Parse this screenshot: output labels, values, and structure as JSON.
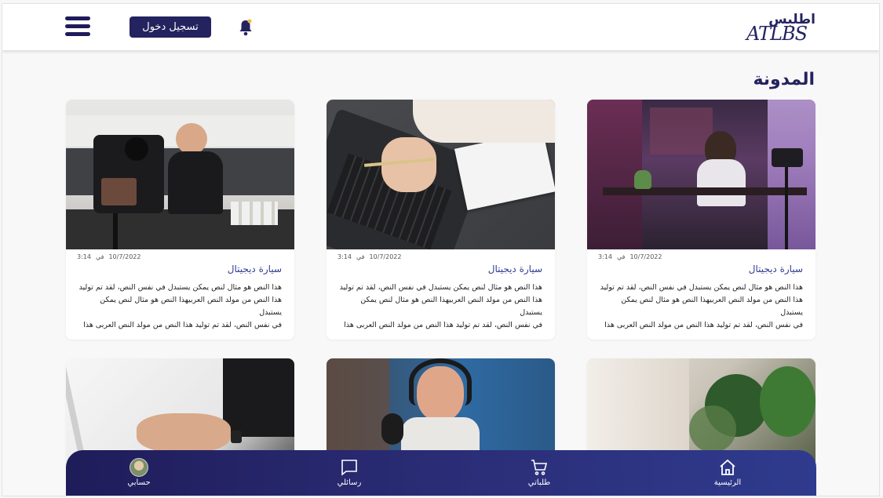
{
  "header": {
    "login_label": "تسجيل دخول",
    "logo_ar": "اطلبس",
    "logo_en": "ATLBS"
  },
  "page": {
    "title": "المدونة"
  },
  "cards": [
    {
      "date": "10/7/2022",
      "at": "في",
      "time": "3:14",
      "title": "سيارة ديجيتال",
      "line1": "هذا النص هو مثال لنص يمكن يستبدل في نفس النص، لقد تم توليد",
      "line2": "هذا النص من مولد النص العربيهذا النص هو مثال لنص يمكن يستبدل",
      "line3": "في نفس النص، لقد تم توليد هذا النص من مولد النص العربى هذا"
    },
    {
      "date": "10/7/2022",
      "at": "في",
      "time": "3:14",
      "title": "سيارة ديجيتال",
      "line1": "هذا النص هو مثال لنص يمكن يستبدل في نفس النص، لقد تم توليد",
      "line2": "هذا النص من مولد النص العربيهذا النص هو مثال لنص يمكن يستبدل",
      "line3": "في نفس النص، لقد تم توليد هذا النص من مولد النص العربى هذا"
    },
    {
      "date": "10/7/2022",
      "at": "في",
      "time": "3:14",
      "title": "سيارة ديجيتال",
      "line1": "هذا النص هو مثال لنص يمكن يستبدل في نفس النص، لقد تم توليد",
      "line2": "هذا النص من مولد النص العربيهذا النص هو مثال لنص يمكن يستبدل",
      "line3": "في نفس النص، لقد تم توليد هذا النص من مولد النص العربى هذا"
    }
  ],
  "bottom_nav": {
    "home": "الرئيسية",
    "orders": "طلباتي",
    "messages": "رسائلي",
    "account": "حسابي"
  },
  "colors": {
    "brand": "#24235f",
    "card_title": "#2d3b8f",
    "nav_gradient_start": "#1f1c5a",
    "nav_gradient_end": "#2f3b8e"
  },
  "icons": [
    "menu-icon",
    "bell-icon",
    "home-icon",
    "cart-icon",
    "chat-icon",
    "avatar"
  ]
}
